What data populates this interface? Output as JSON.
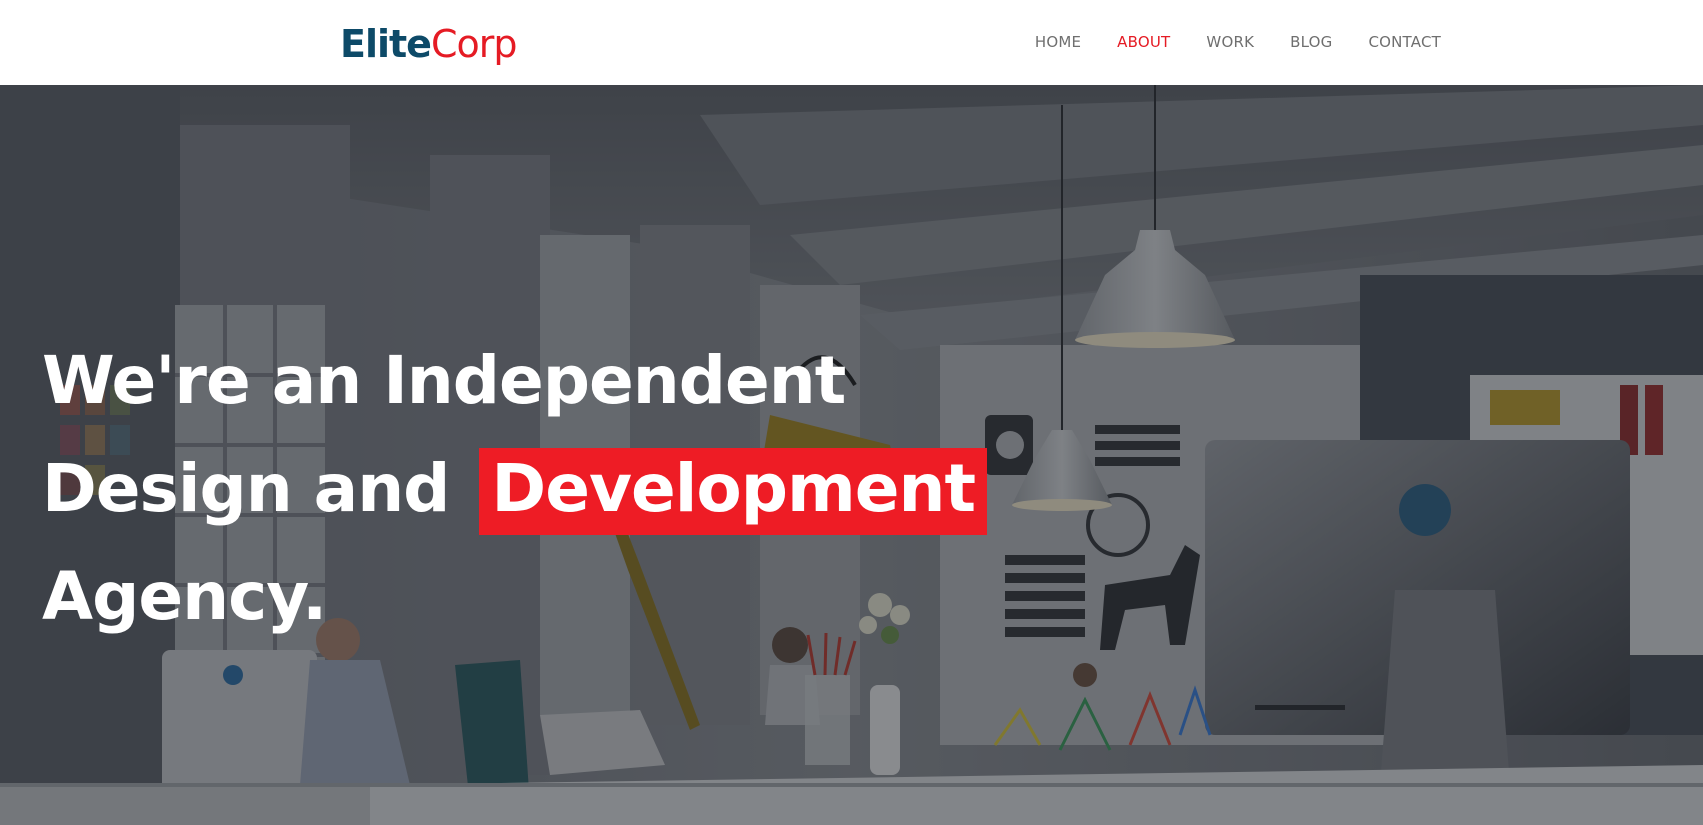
{
  "brand": {
    "part1": "Elite",
    "part2": "Corp"
  },
  "nav": {
    "items": [
      {
        "label": "HOME"
      },
      {
        "label": "ABOUT"
      },
      {
        "label": "WORK"
      },
      {
        "label": "BLOG"
      },
      {
        "label": "CONTACT"
      }
    ],
    "active": "ABOUT"
  },
  "hero": {
    "line1": "We're an Independent",
    "line2_prefix": "Design and",
    "line2_highlight": "Development",
    "line3": "Agency."
  },
  "colors": {
    "brand_dark": "#0d4a68",
    "accent_red": "#e51b24",
    "nav_text": "#6f6f6f",
    "highlight_bg": "#ee1c25"
  }
}
